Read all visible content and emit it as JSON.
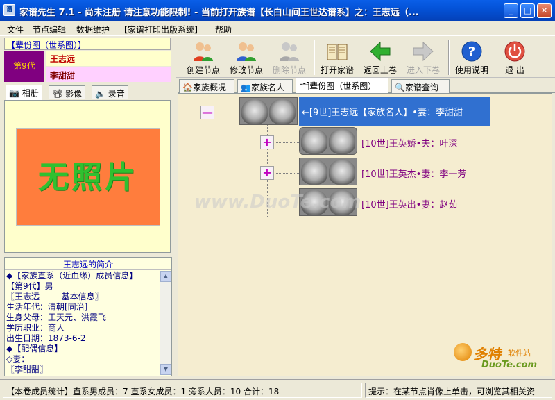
{
  "window": {
    "title": "家谱先生  7.1 - 尚未注册 请注意功能限制!  - 当前打开族谱【长白山间王世达谱系】之：王志远（...",
    "minimize": "_",
    "maximize": "□",
    "close": "✕"
  },
  "menu": [
    "文件",
    "节点编辑",
    "数据维护",
    "【家谱打印出版系统】",
    "帮助"
  ],
  "left": {
    "header": "【辈份图（世系图）】",
    "generation": "第9代",
    "person_name": "王志远",
    "spouse_name": "李甜甜",
    "media_tabs": [
      "相册",
      "影像",
      "录音"
    ],
    "no_photo": "无照片",
    "intro_title": "王志远的简介",
    "intro_lines": [
      "◆【家族直系（近血缘）成员信息】",
      "  【第9代】男",
      "  〖王志远 —— 基本信息〗",
      "    生活年代：清朝[同治]",
      "    生身父母：王天元、洪霞飞",
      "    学历职业：商人",
      "    出生日期：1873-6-2",
      "◆【配偶信息】",
      "◇妻：",
      "  〖李甜甜〗"
    ]
  },
  "toolbar": {
    "create_node": "创建节点",
    "edit_node": "修改节点",
    "delete_node": "删除节点",
    "open_tree": "打开家谱",
    "back": "返回上卷",
    "forward": "进入下卷",
    "help": "使用说明",
    "exit": "退  出"
  },
  "main_tabs": [
    "家族概况",
    "家族名人",
    "辈份图（世系图）",
    "家谱查询"
  ],
  "tree": {
    "root_label": "←[9世]王志远【家族名人】•妻：李甜甜",
    "children": [
      {
        "label": "[10世]王英娇•夫：叶深"
      },
      {
        "label": "[10世]王英杰•妻：李一芳"
      },
      {
        "label": "[10世]王英出•妻：赵茹"
      }
    ],
    "collapse_symbol": "—",
    "expand_symbol": "+"
  },
  "watermark": "www.DuoTe.com",
  "status": {
    "left": "【本卷成员统计】直系男成员：7  直系女成员：1  旁系人员：10  合计：18",
    "right": "提示：在某节点肖像上单击，可浏览其相关资"
  },
  "logo": {
    "big": "多特",
    "small": "软件站",
    "domain": "DuoTe.com"
  },
  "colors": {
    "titlebar": "#0453D8",
    "generation_box": "#800080",
    "no_photo_bg": "#FF7D3D",
    "root_highlight": "#3070D0",
    "tree_bg": "#F5EDD0"
  }
}
